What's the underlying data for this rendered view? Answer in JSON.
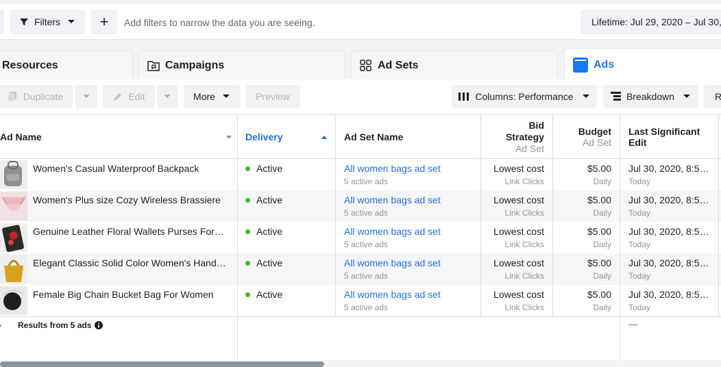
{
  "filterbar": {
    "filters_label": "Filters",
    "add_label": "+",
    "placeholder": "Add filters to narrow the data you are seeing.",
    "date_range": "Lifetime: Jul 29, 2020 – Jul 30,"
  },
  "tabs": [
    {
      "label": "Resources"
    },
    {
      "label": "Campaigns"
    },
    {
      "label": "Ad Sets"
    },
    {
      "label": "Ads"
    }
  ],
  "toolbar": {
    "duplicate": "Duplicate",
    "edit": "Edit",
    "more": "More",
    "preview": "Preview",
    "columns": "Columns: Performance",
    "breakdown": "Breakdown",
    "reports": "R"
  },
  "table": {
    "headers": {
      "ad_name": "Ad Name",
      "delivery": "Delivery",
      "ad_set_name": "Ad Set Name",
      "bid_strategy": "Bid Strategy",
      "bid_strategy_sub": "Ad Set",
      "budget": "Budget",
      "budget_sub": "Ad Set",
      "last_edit": "Last Significant Edit"
    },
    "rows": [
      {
        "name": "Women's Casual Waterproof Backpack",
        "delivery": "Active",
        "ad_set": "All women bags ad set",
        "ad_set_sub": "5 active ads",
        "bid": "Lowest cost",
        "bid_sub": "Link Clicks",
        "budget": "$5.00",
        "budget_sub": "Daily",
        "edit": "Jul 30, 2020, 8:5…",
        "edit_sub": "Today"
      },
      {
        "name": "Women's Plus size Cozy Wireless Brassiere",
        "delivery": "Active",
        "ad_set": "All women bags ad set",
        "ad_set_sub": "5 active ads",
        "bid": "Lowest cost",
        "bid_sub": "Link Clicks",
        "budget": "$5.00",
        "budget_sub": "Daily",
        "edit": "Jul 30, 2020, 8:5…",
        "edit_sub": "Today"
      },
      {
        "name": "Genuine Leather Floral Wallets Purses For…",
        "delivery": "Active",
        "ad_set": "All women bags ad set",
        "ad_set_sub": "5 active ads",
        "bid": "Lowest cost",
        "bid_sub": "Link Clicks",
        "budget": "$5.00",
        "budget_sub": "Daily",
        "edit": "Jul 30, 2020, 8:5…",
        "edit_sub": "Today"
      },
      {
        "name": "Elegant Classic Solid Color Women's Hand…",
        "delivery": "Active",
        "ad_set": "All women bags ad set",
        "ad_set_sub": "5 active ads",
        "bid": "Lowest cost",
        "bid_sub": "Link Clicks",
        "budget": "$5.00",
        "budget_sub": "Daily",
        "edit": "Jul 30, 2020, 8:5…",
        "edit_sub": "Today"
      },
      {
        "name": "Female Big Chain Bucket Bag For Women",
        "delivery": "Active",
        "ad_set": "All women bags ad set",
        "ad_set_sub": "5 active ads",
        "bid": "Lowest cost",
        "bid_sub": "Link Clicks",
        "budget": "$5.00",
        "budget_sub": "Daily",
        "edit": "Jul 30, 2020, 8:5…",
        "edit_sub": "Today"
      }
    ],
    "footer": {
      "results": "Results from 5 ads",
      "last_edit": "—"
    }
  }
}
